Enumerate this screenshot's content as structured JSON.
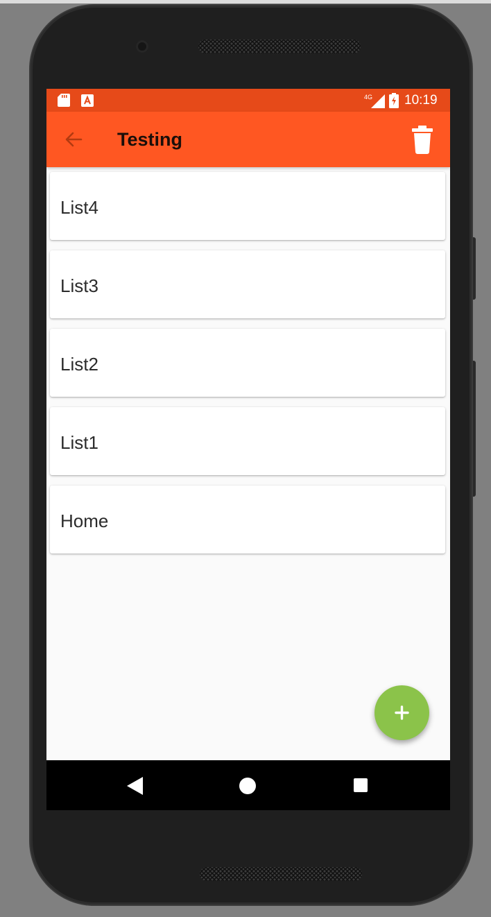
{
  "status_bar": {
    "icons": [
      "sd-card-icon",
      "a-notification-icon",
      "signal-4g-icon",
      "battery-charging-icon"
    ],
    "network_label": "4G",
    "time": "10:19"
  },
  "app_bar": {
    "title": "Testing",
    "back_icon": "arrow-back-icon",
    "action_icon": "delete-icon"
  },
  "list": {
    "items": [
      {
        "label": "List4"
      },
      {
        "label": "List3"
      },
      {
        "label": "List2"
      },
      {
        "label": "List1"
      },
      {
        "label": "Home"
      }
    ]
  },
  "fab": {
    "icon": "add-icon",
    "symbol": "+"
  },
  "nav_bar": {
    "icons": [
      "nav-back-icon",
      "nav-home-icon",
      "nav-recents-icon"
    ]
  },
  "colors": {
    "status_bar": "#e64a19",
    "app_bar": "#ff5722",
    "fab": "#8bc34a",
    "background": "#fafafa"
  }
}
